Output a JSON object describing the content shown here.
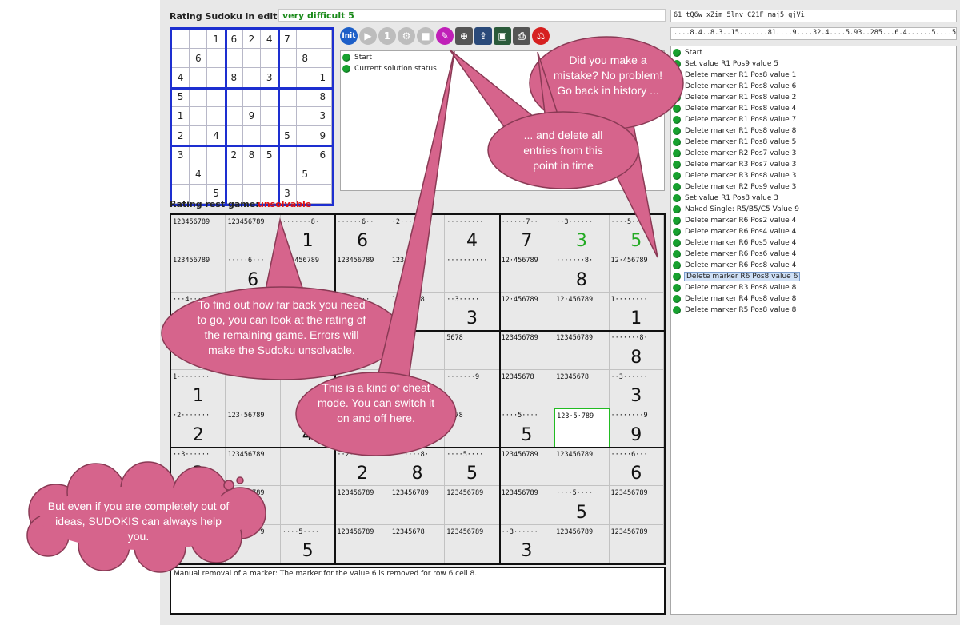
{
  "header": {
    "rating_label": "Rating Sudoku in editor:",
    "rating_value": "very difficult 5",
    "rating_color": "#1a8a1a",
    "rest_label": "Rating rest game:",
    "rest_value": "unsolvable",
    "rest_color": "#e01010"
  },
  "code_field_1": "61 tQ6w xZim 5lnv C21F maj5 gjVi",
  "code_field_2": "....8.4..8.3..15.......81....9....32.4....5.93..285...6.4......5....5....3...",
  "small_grid": [
    [
      "",
      "",
      "1",
      "6",
      "2",
      "4",
      "7",
      "",
      ""
    ],
    [
      "",
      "6",
      "",
      "",
      "",
      "",
      "",
      "8",
      ""
    ],
    [
      "4",
      "",
      "",
      "8",
      "",
      "3",
      "",
      "",
      "1"
    ],
    [
      "5",
      "",
      "",
      "",
      "",
      "",
      "",
      "",
      "8"
    ],
    [
      "1",
      "",
      "",
      "",
      "9",
      "",
      "",
      "",
      "3"
    ],
    [
      "2",
      "",
      "4",
      "",
      "",
      "",
      "5",
      "",
      "9"
    ],
    [
      "3",
      "",
      "",
      "2",
      "8",
      "5",
      "",
      "",
      "6"
    ],
    [
      "",
      "4",
      "",
      "",
      "",
      "",
      "",
      "5",
      ""
    ],
    [
      "",
      "",
      "5",
      "",
      "",
      "",
      "3",
      "",
      ""
    ]
  ],
  "toolbar": {
    "init_label": "Init",
    "icons": [
      "init-icon",
      "play-icon",
      "step-icon",
      "run-icon",
      "stop-icon",
      "cheat-mode-icon",
      "globe-icon",
      "export-icon",
      "save-icon",
      "print-icon",
      "rating-scale-icon"
    ]
  },
  "history_left": [
    "Start",
    "Current solution status"
  ],
  "big_grid": {
    "cand": [
      [
        "123456789",
        "123456789",
        "·······8·",
        "······6··",
        "·2·······",
        "·········",
        "······7··",
        "··3······",
        "····5····"
      ],
      [
        "123456789",
        "·····6···",
        "···456789",
        "123456789",
        "12345678",
        "··········",
        "12·456789",
        "·······8·",
        "12·456789"
      ],
      [
        "···4·····",
        "",
        "",
        "··8·····",
        "12345678",
        "··3·····",
        "12·456789",
        "12·456789",
        "1········"
      ],
      [
        "",
        "",
        "",
        "",
        "",
        "5678",
        "123456789",
        "123456789",
        "·······8·"
      ],
      [
        "1········",
        "",
        "",
        "",
        "",
        "·······9",
        "12345678",
        "12345678",
        "··3······"
      ],
      [
        "·2·······",
        "123·56789",
        "",
        "",
        "",
        "5678",
        "····5····",
        "123·5·789",
        "········9"
      ],
      [
        "··3······",
        "123456789",
        "",
        "··2·····",
        "·······8·",
        "····5····",
        "123456789",
        "123456789",
        "·····6···"
      ],
      [
        "",
        "123456789",
        "",
        "123456789",
        "123456789",
        "123456789",
        "123456789",
        "····5····",
        "123456789"
      ],
      [
        "",
        "········9",
        "····5····",
        "123456789",
        "12345678",
        "123456789",
        "··3······",
        "123456789",
        "123456789"
      ]
    ],
    "vals": [
      [
        "",
        "",
        "1",
        "6",
        "2",
        "4",
        "7",
        "3",
        "5"
      ],
      [
        "",
        "6",
        "",
        "",
        "",
        "",
        "",
        "8",
        ""
      ],
      [
        "",
        "",
        "",
        "",
        "",
        "3",
        "",
        "",
        "1"
      ],
      [
        "",
        "",
        "",
        "",
        "",
        "",
        "",
        "",
        "8"
      ],
      [
        "1",
        "",
        "",
        "",
        "",
        "",
        "",
        "",
        "3"
      ],
      [
        "2",
        "",
        "4",
        "",
        "",
        "",
        "5",
        "",
        "9"
      ],
      [
        "3",
        "",
        "",
        "2",
        "8",
        "5",
        "",
        "",
        "6"
      ],
      [
        "",
        "",
        "",
        "",
        "",
        "",
        "",
        "5",
        ""
      ],
      [
        "",
        "",
        "5",
        "",
        "",
        "",
        "3",
        "",
        ""
      ]
    ],
    "green_cells": [
      [
        0,
        7
      ],
      [
        0,
        8
      ]
    ],
    "highlight_cell": [
      5,
      7
    ]
  },
  "message": "Manual removal of a marker: The marker for the value 6 is removed for row 6 cell 8.",
  "history_right": [
    "Start",
    "Set value R1 Pos9 value 5",
    "Delete marker R1 Pos8 value 1",
    "Delete marker R1 Pos8 value 6",
    "Delete marker R1 Pos8 value 2",
    "Delete marker R1 Pos8 value 4",
    "Delete marker R1 Pos8 value 7",
    "Delete marker R1 Pos8 value 8",
    "Delete marker R1 Pos8 value 5",
    "Delete marker R2 Pos7 value 3",
    "Delete marker R3 Pos7 value 3",
    "Delete marker R3 Pos8 value 3",
    "Delete marker R2 Pos9 value 3",
    "Set value R1 Pos8 value 3",
    "Naked Single: R5/B5/C5 Value 9",
    "Delete marker R6 Pos2 value 4",
    "Delete marker R6 Pos4 value 4",
    "Delete marker R6 Pos5 value 4",
    "Delete marker R6 Pos6 value 4",
    "Delete marker R6 Pos8 value 4",
    "Delete marker R6 Pos8 value 6",
    "Delete marker R3 Pos8 value 8",
    "Delete marker R4 Pos8 value 8",
    "Delete marker R5 Pos8 value 8"
  ],
  "selected_history_index": 20,
  "callouts": {
    "mistake": "Did you make a mistake? No problem! Go back in history ...",
    "delete": "... and delete all entries from this point in time",
    "rating": "To find out how far back you need to go, you can look at the rating of the remaining game. Errors will make the Sudoku unsolvable.",
    "cheat": "This is a kind of cheat mode. You can switch it on and off here.",
    "help": "But even if you are completely out of ideas, SUDOKIS can always help you."
  },
  "callout_color": "#d6648c"
}
